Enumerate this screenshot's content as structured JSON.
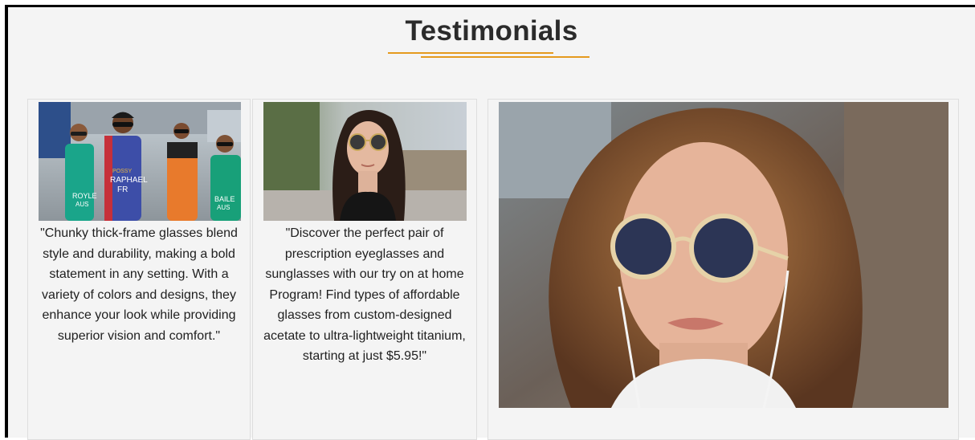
{
  "section": {
    "title": "Testimonials",
    "accent_color": "#e59a1e"
  },
  "testimonials": [
    {
      "image": "marathon-runners-sunglasses-photo",
      "image_text": [
        "POSSY",
        "RAPHAEL",
        "FR",
        "ROYLE",
        "AUS",
        "BAILE",
        "AUS"
      ],
      "quote": "\"Chunky thick-frame glasses blend style and durability, making a bold statement in any setting. With a variety of colors and designs, they enhance your look while providing superior vision and comfort.\""
    },
    {
      "image": "woman-round-sunglasses-street-photo",
      "quote": "\"Discover the perfect pair of prescription eyeglasses and sunglasses with our try on at home Program! Find types of affordable glasses from custom-designed acetate to ultra-lightweight titanium, starting at just $5.95!\""
    }
  ],
  "featured": {
    "image": "woman-steampunk-round-sunglasses-earphones-photo"
  }
}
